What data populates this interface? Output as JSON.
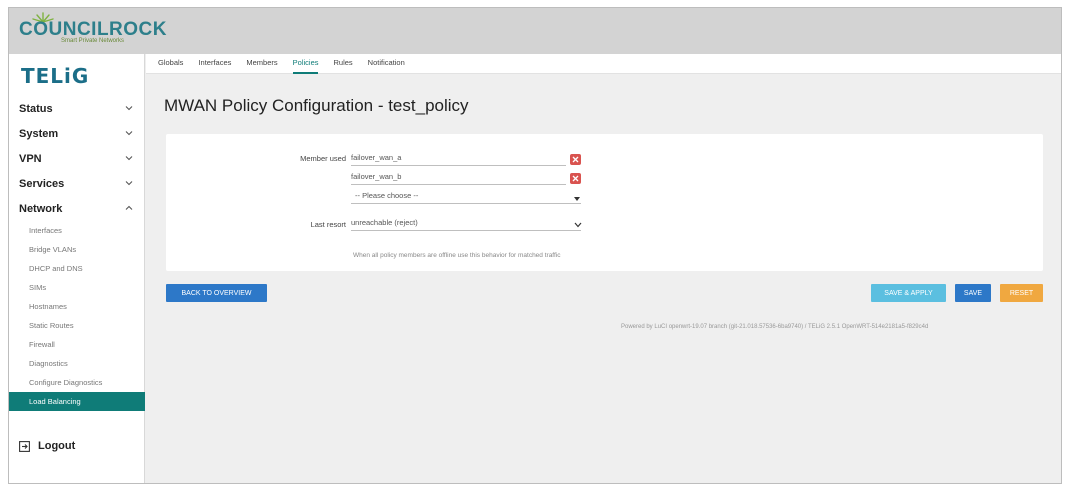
{
  "brand": {
    "name": "COUNCILROCK",
    "tagline": "Smart Private Networks",
    "product_logo": "TELiG",
    "accent": "#0f7c78"
  },
  "sidebar": {
    "items": [
      {
        "label": "Status",
        "icon": "chevron-down-icon"
      },
      {
        "label": "System",
        "icon": "chevron-down-icon"
      },
      {
        "label": "VPN",
        "icon": "chevron-down-icon"
      },
      {
        "label": "Services",
        "icon": "chevron-down-icon"
      },
      {
        "label": "Network",
        "icon": "chevron-up-icon"
      }
    ],
    "network_sub": [
      "Interfaces",
      "Bridge VLANs",
      "DHCP and DNS",
      "SIMs",
      "Hostnames",
      "Static Routes",
      "Firewall",
      "Diagnostics",
      "Configure Diagnostics",
      "Load Balancing"
    ],
    "active_sub": "Load Balancing",
    "logout": "Logout"
  },
  "tabs": [
    "Globals",
    "Interfaces",
    "Members",
    "Policies",
    "Rules",
    "Notification"
  ],
  "active_tab": "Policies",
  "main": {
    "title": "MWAN Policy Configuration - test_policy",
    "member_used_label": "Member used",
    "members": [
      "failover_wan_a",
      "failover_wan_b"
    ],
    "member_select_placeholder": "-- Please choose --",
    "last_resort_label": "Last resort",
    "last_resort_value": "unreachable (reject)",
    "last_resort_help": "When all policy members are offline use this behavior for matched traffic"
  },
  "buttons": {
    "back": "BACK TO OVERVIEW",
    "save_apply": "SAVE & APPLY",
    "save": "SAVE",
    "reset": "RESET"
  },
  "footer": "Powered by LuCI openwrt-19.07 branch (git-21.018.57536-6ba9740) / TELiG 2.5.1 OpenWRT-514e2181a5-f829c4d"
}
